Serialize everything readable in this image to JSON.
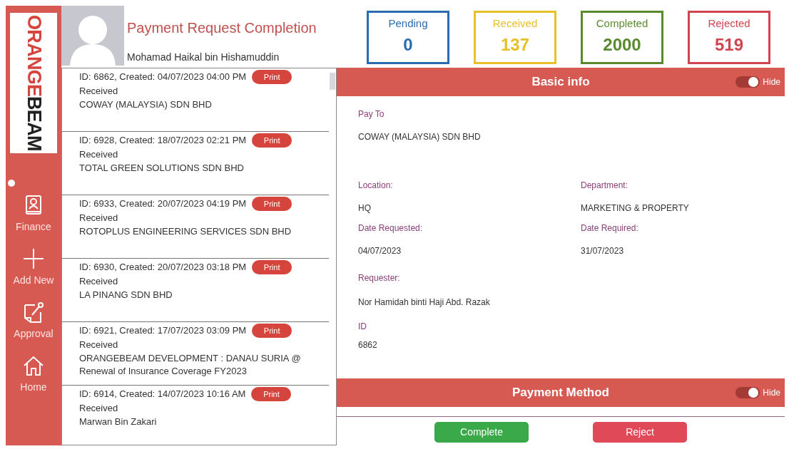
{
  "sidebar": {
    "logo": {
      "first": "ORANGE",
      "second": "BEAM"
    },
    "items": [
      {
        "label": "Finance",
        "kind": "book",
        "selected": true
      },
      {
        "label": "Add New",
        "kind": "plus",
        "selected": false
      },
      {
        "label": "Approval",
        "kind": "note",
        "selected": false
      },
      {
        "label": "Home",
        "kind": "home",
        "selected": false
      }
    ]
  },
  "header": {
    "title": "Payment Request Completion",
    "user": "Mohamad Haikal bin Hishamuddin"
  },
  "stats": [
    {
      "label": "Pending",
      "value": "0",
      "color": "#2b6cb0"
    },
    {
      "label": "Received",
      "value": "137",
      "color": "#e8c02a"
    },
    {
      "label": "Completed",
      "value": "2000",
      "color": "#5a8a2e"
    },
    {
      "label": "Rejected",
      "value": "519",
      "color": "#d0444f"
    }
  ],
  "requests": [
    {
      "line": "ID: 6862, Created: 04/07/2023 04:00 PM",
      "status": "Received",
      "payee": "COWAY (MALAYSIA) SDN BHD",
      "print": "Print"
    },
    {
      "line": "ID: 6928, Created: 18/07/2023 02:21 PM",
      "status": "Received",
      "payee": "TOTAL GREEN SOLUTIONS SDN BHD",
      "print": "Print"
    },
    {
      "line": "ID: 6933, Created: 20/07/2023 04:19 PM",
      "status": "Received",
      "payee": "ROTOPLUS ENGINEERING SERVICES SDN BHD",
      "print": "Print"
    },
    {
      "line": "ID: 6930, Created: 20/07/2023 03:18 PM",
      "status": "Received",
      "payee": "LA PINANG SDN BHD",
      "print": "Print"
    },
    {
      "line": "ID: 6921, Created: 17/07/2023 03:09 PM",
      "status": "Received",
      "payee": "ORANGEBEAM DEVELOPMENT : DANAU SURIA @ Renewal of Insurance Coverage FY2023",
      "print": "Print"
    },
    {
      "line": "ID: 6914, Created: 14/07/2023 10:16 AM",
      "status": "Received",
      "payee": "Marwan Bin Zakari",
      "print": "Print"
    }
  ],
  "basic_info": {
    "title": "Basic info",
    "toggle": {
      "label": "Hide",
      "on": true
    },
    "pay_to": {
      "label": "Pay To",
      "value": "COWAY (MALAYSIA) SDN BHD"
    },
    "fields": [
      {
        "label": "Location:",
        "value": "HQ"
      },
      {
        "label": "Department:",
        "value": "MARKETING & PROPERTY"
      },
      {
        "label": "Date Requested:",
        "value": "04/07/2023"
      },
      {
        "label": "Date Required:",
        "value": "31/07/2023"
      }
    ],
    "requester": {
      "label": "Requester:",
      "value": "Nor Hamidah binti Haji Abd. Razak"
    },
    "id": {
      "label": "ID",
      "value": "6862"
    }
  },
  "payment_method": {
    "title": "Payment Method",
    "toggle": {
      "label": "Hide",
      "on": true
    }
  },
  "actions": [
    {
      "label": "Complete",
      "kind": "complete"
    },
    {
      "label": "Reject",
      "kind": "reject"
    }
  ]
}
